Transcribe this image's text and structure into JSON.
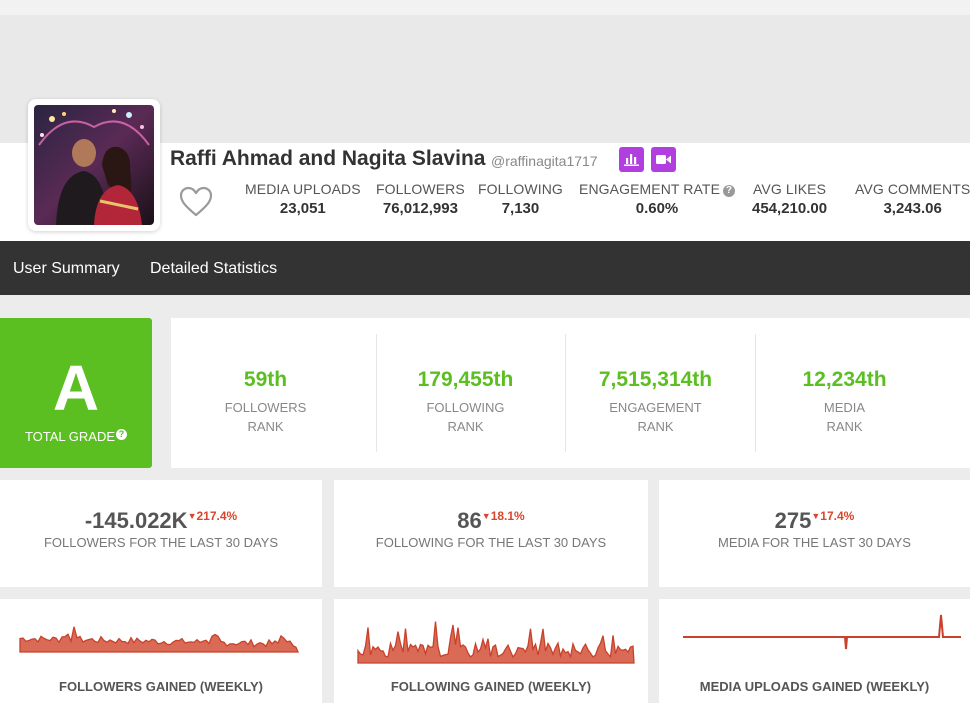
{
  "profile": {
    "name": "Raffi Ahmad and Nagita Slavina",
    "handle": "@raffinagita1717",
    "stats": [
      {
        "label": "MEDIA UPLOADS",
        "value": "23,051"
      },
      {
        "label": "FOLLOWERS",
        "value": "76,012,993"
      },
      {
        "label": "FOLLOWING",
        "value": "7,130"
      },
      {
        "label": "ENGAGEMENT RATE",
        "value": "0.60%"
      },
      {
        "label": "AVG LIKES",
        "value": "454,210.00"
      },
      {
        "label": "AVG COMMENTS",
        "value": "3,243.06"
      }
    ]
  },
  "nav": {
    "tabs": [
      {
        "label": "User Summary"
      },
      {
        "label": "Detailed Statistics"
      }
    ]
  },
  "grade": {
    "letter": "A",
    "label": "TOTAL GRADE"
  },
  "ranks": [
    {
      "value": "59th",
      "line1": "FOLLOWERS",
      "line2": "RANK"
    },
    {
      "value": "179,455th",
      "line1": "FOLLOWING",
      "line2": "RANK"
    },
    {
      "value": "7,515,314th",
      "line1": "ENGAGEMENT",
      "line2": "RANK"
    },
    {
      "value": "12,234th",
      "line1": "MEDIA",
      "line2": "RANK"
    }
  ],
  "last30": [
    {
      "value": "-145.022K",
      "change": "217.4%",
      "label": "FOLLOWERS FOR THE LAST 30 DAYS"
    },
    {
      "value": "86",
      "change": "18.1%",
      "label": "FOLLOWING FOR THE LAST 30 DAYS"
    },
    {
      "value": "275",
      "change": "17.4%",
      "label": "MEDIA FOR THE LAST 30 DAYS"
    }
  ],
  "charts": [
    {
      "title": "FOLLOWERS GAINED (WEEKLY)"
    },
    {
      "title": "FOLLOWING GAINED (WEEKLY)"
    },
    {
      "title": "MEDIA UPLOADS GAINED (WEEKLY)"
    }
  ],
  "colors": {
    "grade_green": "#5bbf21",
    "nav_dark": "#333333",
    "accent_purple": "#b13fe0",
    "negative_red": "#d9452b",
    "sparkline_red": "#c9412b"
  },
  "icons": [
    "favorite-heart-icon",
    "bar-chart-icon",
    "video-camera-icon",
    "help-icon"
  ]
}
